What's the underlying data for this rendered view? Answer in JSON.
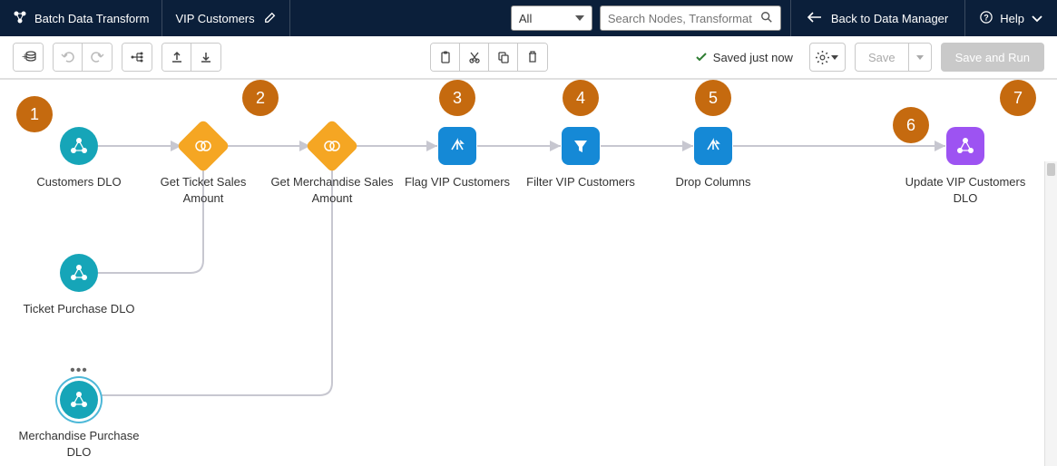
{
  "header": {
    "app_title": "Batch Data Transform",
    "tab_name": "VIP Customers",
    "filter_selected": "All",
    "search_placeholder": "Search Nodes, Transformat",
    "back_label": "Back to Data Manager",
    "help_label": "Help"
  },
  "toolbar": {
    "status_text": "Saved just now",
    "save_label": "Save",
    "save_run_label": "Save and Run"
  },
  "markers": {
    "m1": "1",
    "m2": "2",
    "m3": "3",
    "m4": "4",
    "m5": "5",
    "m6": "6",
    "m7": "7"
  },
  "nodes": {
    "customers_dlo": "Customers DLO",
    "get_ticket": "Get Ticket Sales Amount",
    "get_merch": "Get Merchandise Sales Amount",
    "flag_vip": "Flag VIP Customers",
    "filter_vip": "Filter VIP Customers",
    "drop_cols": "Drop Columns",
    "update_vip": "Update VIP Customers DLO",
    "ticket_dlo": "Ticket Purchase DLO",
    "merch_dlo": "Merchandise Purchase DLO"
  }
}
